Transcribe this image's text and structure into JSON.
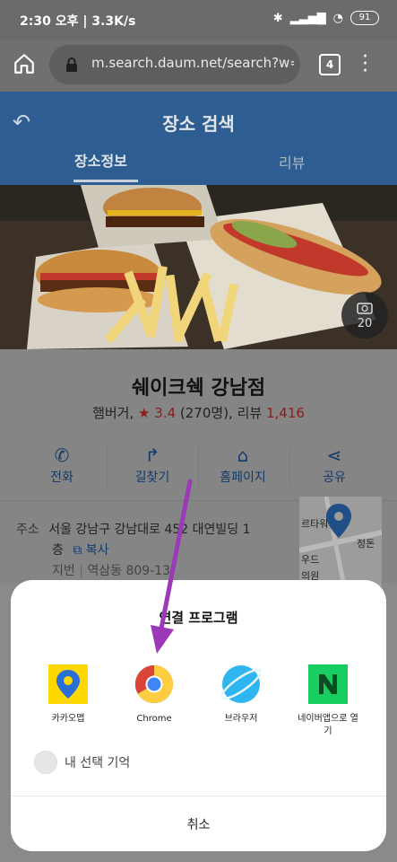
{
  "status_bar": {
    "time": "2:30 오후 | 3.3K/s",
    "battery": "91",
    "icons": [
      "bluetooth-icon",
      "signal-icon",
      "wifi-icon"
    ]
  },
  "browser": {
    "url": "m.search.daum.net/search?w=p",
    "tab_count": "4"
  },
  "header": {
    "title": "장소 검색",
    "tabs": [
      "장소정보",
      "리뷰"
    ]
  },
  "photo": {
    "count": "20"
  },
  "place": {
    "name": "쉐이크쉑 강남점",
    "category": "햄버거,",
    "rating": "3.4",
    "rating_count": "(270명), 리뷰",
    "review_count": "1,416",
    "actions": [
      "전화",
      "길찾기",
      "홈페이지",
      "공유"
    ],
    "address_label": "주소",
    "address_line1": "서울 강남구 강남대로 452 대연빌딩 1",
    "address_line2": "층",
    "copy": "복사",
    "lot_label": "지번",
    "lot_value": "역삼동 809-13",
    "map_labels": [
      "르타워",
      "정돈",
      "우드",
      "의원"
    ]
  },
  "sheet": {
    "title": "연결 프로그램",
    "apps": [
      {
        "label": "카카오맵"
      },
      {
        "label": "Chrome"
      },
      {
        "label": "브라우저"
      },
      {
        "label": "네이버앱으로 열기"
      }
    ],
    "remember": "내 선택 기억",
    "cancel": "취소"
  },
  "colors": {
    "header_blue": "#2e5e91",
    "accent_purple": "#9b39b8",
    "kakao_yellow": "#ffd700",
    "naver_green": "#19ce60"
  }
}
